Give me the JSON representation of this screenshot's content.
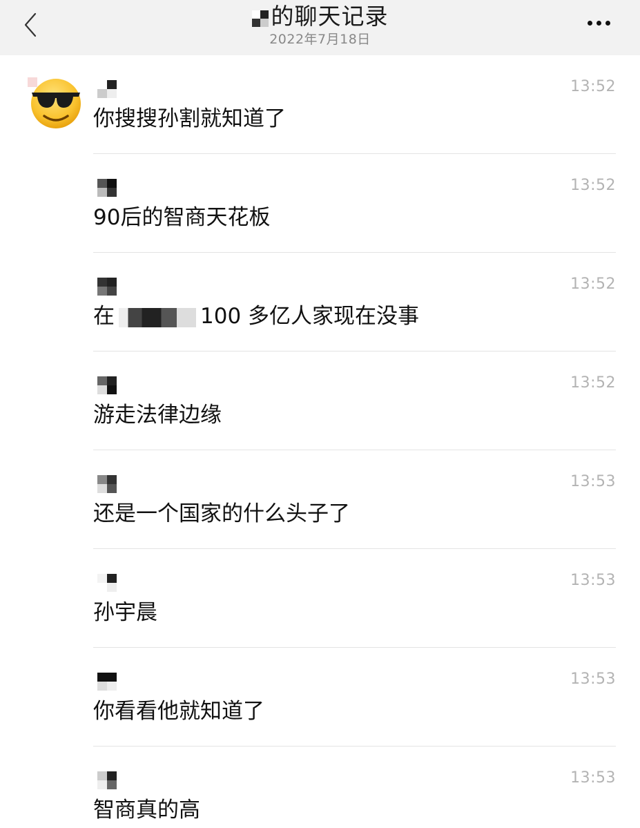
{
  "header": {
    "title": "的聊天记录",
    "date": "2022年7月18日"
  },
  "icons": {
    "back": "chevron-left-icon",
    "more": "more-dots-icon",
    "avatar": "sunglasses-emoji-avatar"
  },
  "messages": [
    {
      "time": "13:52",
      "text": "你搜搜孙割就知道了"
    },
    {
      "time": "13:52",
      "text": "90后的智商天花板"
    },
    {
      "time": "13:52",
      "text_before": "在",
      "text_after": "100 多亿人家现在没事"
    },
    {
      "time": "13:52",
      "text": "游走法律边缘"
    },
    {
      "time": "13:53",
      "text": "还是一个国家的什么头子了"
    },
    {
      "time": "13:53",
      "text": "孙宇晨"
    },
    {
      "time": "13:53",
      "text": "你看看他就知道了"
    },
    {
      "time": "13:53",
      "text": "智商真的高"
    }
  ]
}
